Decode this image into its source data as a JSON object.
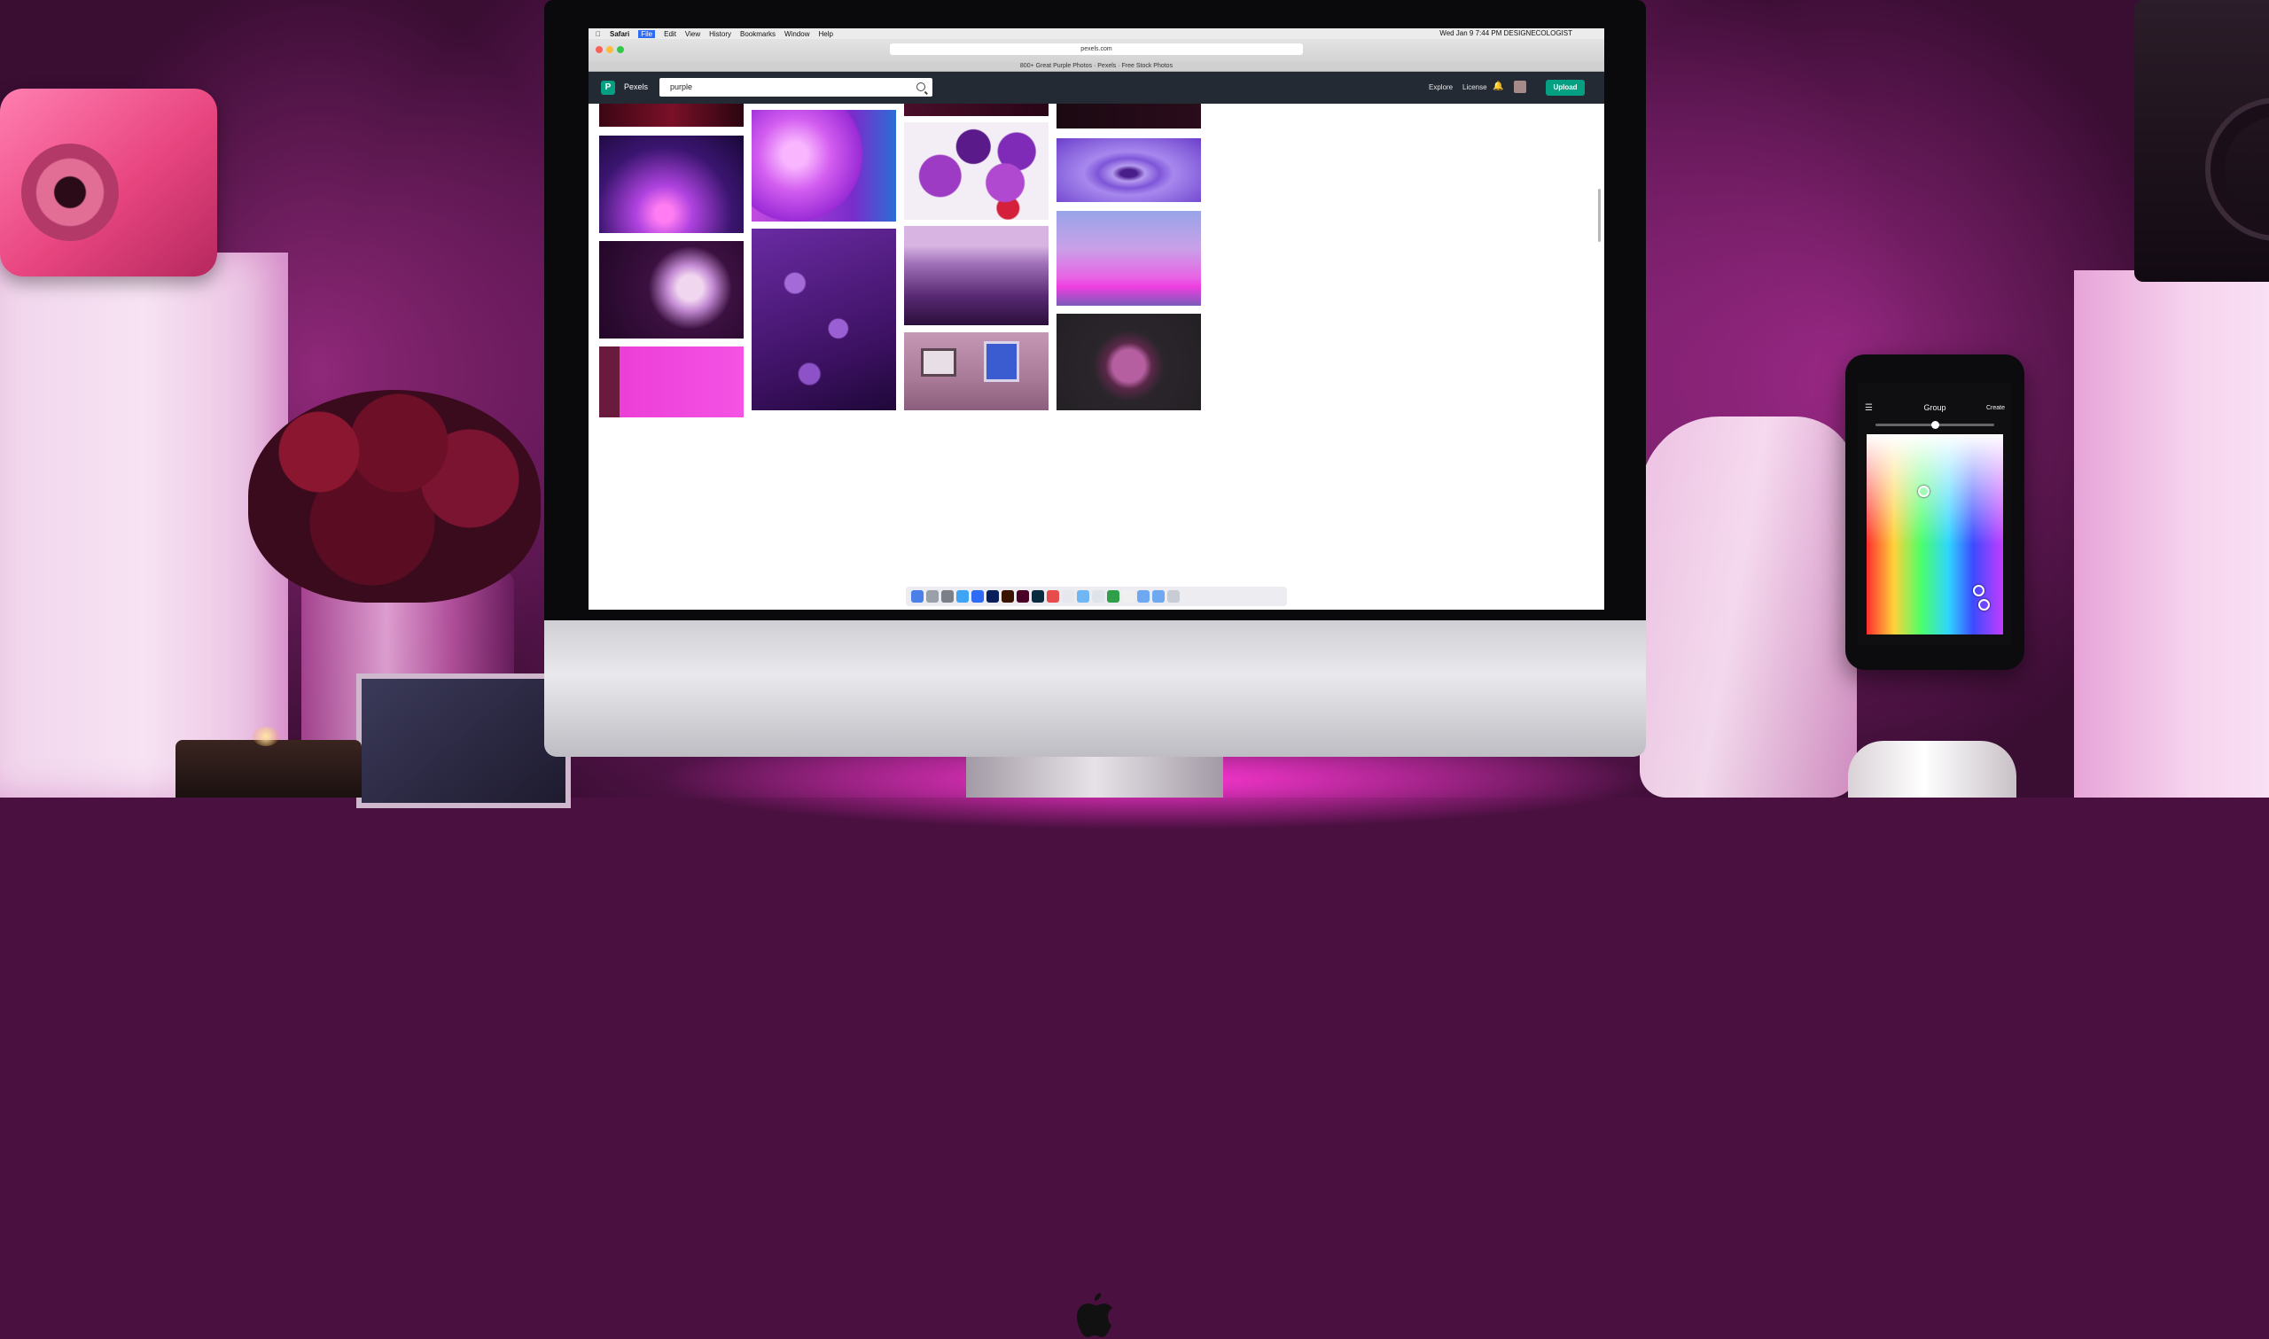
{
  "mac_menubar": {
    "app": "Safari",
    "menus": [
      "File",
      "Edit",
      "View",
      "History",
      "Bookmarks",
      "Window",
      "Help"
    ],
    "clock": "Wed Jan 9 7:44 PM",
    "user": "DESIGNECOLOGIST"
  },
  "browser": {
    "url": "pexels.com",
    "tab_title": "800+ Great Purple Photos · Pexels · Free Stock Photos"
  },
  "pexels": {
    "logo_letter": "P",
    "name": "Pexels",
    "search_value": "purple",
    "nav": [
      "Explore",
      "License"
    ],
    "upload_label": "Upload"
  },
  "phone": {
    "title": "Group",
    "create_label": "Create",
    "slider_level": 0.5
  },
  "colors": {
    "pexels_green": "#05a081",
    "header_dark": "#232a34",
    "ambient_magenta": "#c23aa6"
  },
  "icons": [
    "apple-logo-icon",
    "search-icon",
    "bell-icon",
    "menu-icon"
  ]
}
